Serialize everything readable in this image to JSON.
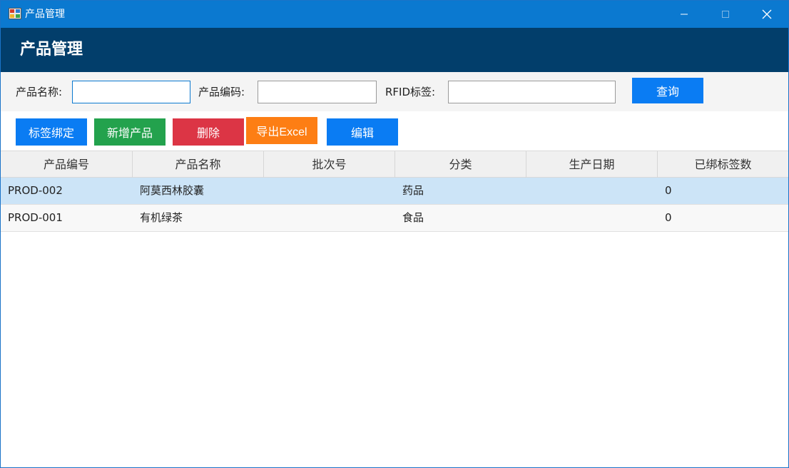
{
  "window": {
    "title": "产品管理",
    "colors": {
      "titlebar": "#0b79d0",
      "header": "#023e6b"
    }
  },
  "header": {
    "title": "产品管理"
  },
  "search": {
    "name_label": "产品名称:",
    "name_value": "",
    "code_label": "产品编码:",
    "code_value": "",
    "rfid_label": "RFID标签:",
    "rfid_value": "",
    "query_label": "查询"
  },
  "toolbar": {
    "bind_label": "标签绑定",
    "add_label": "新增产品",
    "delete_label": "删除",
    "export_label": "导出Excel",
    "edit_label": "编辑",
    "colors": {
      "primary": "#0a7cf3",
      "success": "#23a24d",
      "danger": "#dc3545",
      "warning": "#fd7e14"
    }
  },
  "table": {
    "columns": [
      "产品编号",
      "产品名称",
      "批次号",
      "分类",
      "生产日期",
      "已绑标签数"
    ],
    "rows": [
      {
        "code": "PROD-002",
        "name": "阿莫西林胶囊",
        "batch": "",
        "category": "药品",
        "date": "",
        "tag_count": "0"
      },
      {
        "code": "PROD-001",
        "name": "有机绿茶",
        "batch": "",
        "category": "食品",
        "date": "",
        "tag_count": "0"
      }
    ],
    "selected_row": 0
  }
}
